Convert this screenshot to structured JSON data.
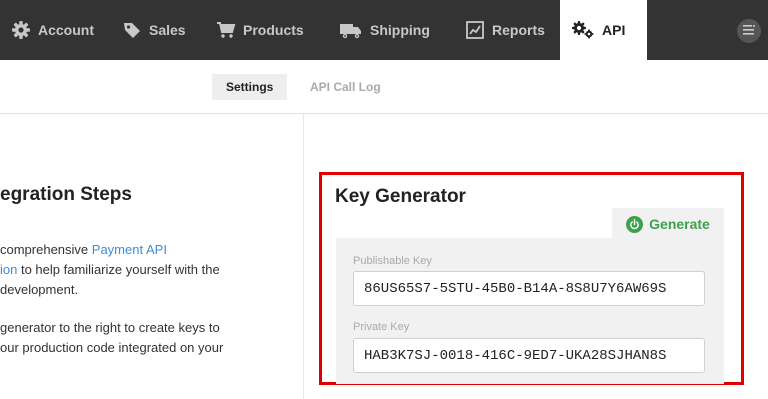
{
  "nav": {
    "items": [
      {
        "label": "Account",
        "icon": "gear-icon"
      },
      {
        "label": "Sales",
        "icon": "tag-icon"
      },
      {
        "label": "Products",
        "icon": "cart-icon"
      },
      {
        "label": "Shipping",
        "icon": "truck-icon"
      },
      {
        "label": "Reports",
        "icon": "chart-icon"
      },
      {
        "label": "API",
        "icon": "gears-icon",
        "active": true
      }
    ],
    "menu_icon": "menu-icon"
  },
  "subnav": {
    "tabs": [
      {
        "label": "Settings",
        "active": true
      },
      {
        "label": "API Call Log"
      }
    ]
  },
  "steps": {
    "title": "egration Steps",
    "para1": {
      "line1_pre": "comprehensive ",
      "line1_link": "Payment API",
      "line2_link": "ion",
      "line2_post": " to help familiarize yourself with the",
      "line3": " development."
    },
    "para2": {
      "line1": "generator to the right to create keys to",
      "line2": "our production code integrated on your"
    }
  },
  "key_generator": {
    "title": "Key Generator",
    "generate_label": "Generate",
    "publishable_label": "Publishable Key",
    "publishable_value": "86US65S7-5STU-45B0-B14A-8S8U7Y6AW69S",
    "private_label": "Private Key",
    "private_value": "HAB3K7SJ-0018-416C-9ED7-UKA28SJHAN8S"
  },
  "colors": {
    "topbar": "#333333",
    "link": "#3b8ed6",
    "generate": "#3aa34a",
    "highlight": "#e00000"
  }
}
